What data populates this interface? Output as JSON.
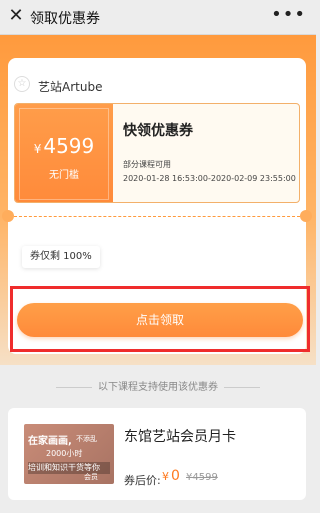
{
  "topbar": {
    "title": "领取优惠券",
    "close_icon": "close-icon",
    "more_icon": "more-icon"
  },
  "brand": {
    "name": "艺站Artube",
    "icon": "star-icon"
  },
  "coupon": {
    "currency": "¥",
    "amount": "4599",
    "threshold": "无门槛",
    "title": "快领优惠券",
    "scope": "部分课程可用",
    "validity": "2020-01-28 16:53:00-2020-02-09 23:55:00"
  },
  "remain": {
    "label": "券仅剩 100%"
  },
  "claim": {
    "label": "点击领取"
  },
  "support_text": "以下课程支持使用该优惠券",
  "course": {
    "title": "东馆艺站会员月卡",
    "after_label": "券后价:",
    "after_currency": "¥",
    "after_value": "0",
    "orig_price": "¥4599",
    "thumb": {
      "line1": "在家画画,",
      "line1_small": "不添乱",
      "line2": "2000小时",
      "line3": "培训和知识干货等你",
      "line4": "会员"
    }
  },
  "colors": {
    "accent": "#ff8a3a",
    "highlight_frame": "#ef2c2c"
  }
}
